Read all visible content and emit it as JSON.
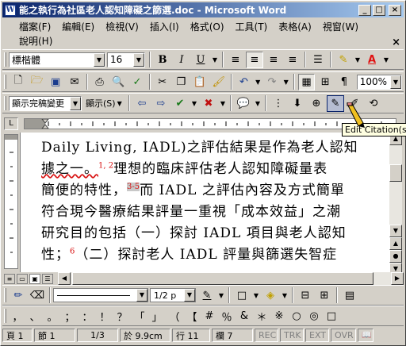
{
  "title": "能之執行為社區老人認知障礙之篩選.doc - Microsoft Word",
  "window_buttons": {
    "minimize": "_",
    "maximize": "□",
    "close": "×"
  },
  "menu": [
    "檔案(F)",
    "編輯(E)",
    "檢視(V)",
    "插入(I)",
    "格式(O)",
    "工具(T)",
    "表格(A)",
    "視窗(W)",
    "說明(H)"
  ],
  "close_doc": "×",
  "format": {
    "font": "標楷體",
    "size": "16"
  },
  "toolbar2": {
    "zoom": "100%"
  },
  "toolbar3": {
    "style": "顯示完稿變更",
    "show": "顯示(S)"
  },
  "tooltip": "Edit Citation(s)",
  "document": {
    "line1": "Daily Living, IADL)之評估結果是作為老人認知",
    "line2_a": "據之一。",
    "line2_sup": "1, 2",
    "line2_b": "理想的臨床評估老人認知障礙量表",
    "line3_a": "簡便的特性，",
    "line3_sup": "3-5",
    "line3_b": "而 IADL 之評估內容及方式簡單",
    "line4": "符合現今醫療結果評量一重視「成本效益」之潮",
    "line5": "研究目的包括（一）探討 IADL 項目與老人認知",
    "line6_a": "性；",
    "line6_sup": "6",
    "line6_b": "（二）探討老人 IADL 評量與篩選失智症"
  },
  "drawing_bar": {
    "line_weight": "1/2 p"
  },
  "symbols": [
    "，",
    "、",
    "。",
    "；",
    "：",
    "！",
    "？",
    "「",
    "」",
    "（",
    "【",
    "#",
    "％",
    "&",
    "＊",
    "※",
    "○",
    "◎",
    "□"
  ],
  "status": {
    "page": "頁 1",
    "section": "節 1",
    "pages": "1/3",
    "at": "於 9.9cm",
    "line": "行 11",
    "col": "欄 7",
    "rec": "REC",
    "trk": "TRK",
    "ext": "EXT",
    "ovr": "OVR"
  },
  "colors": {
    "title_start": "#0a246a",
    "title_end": "#a6caf0",
    "citation": "#d81010",
    "font_color": "#e01010"
  }
}
